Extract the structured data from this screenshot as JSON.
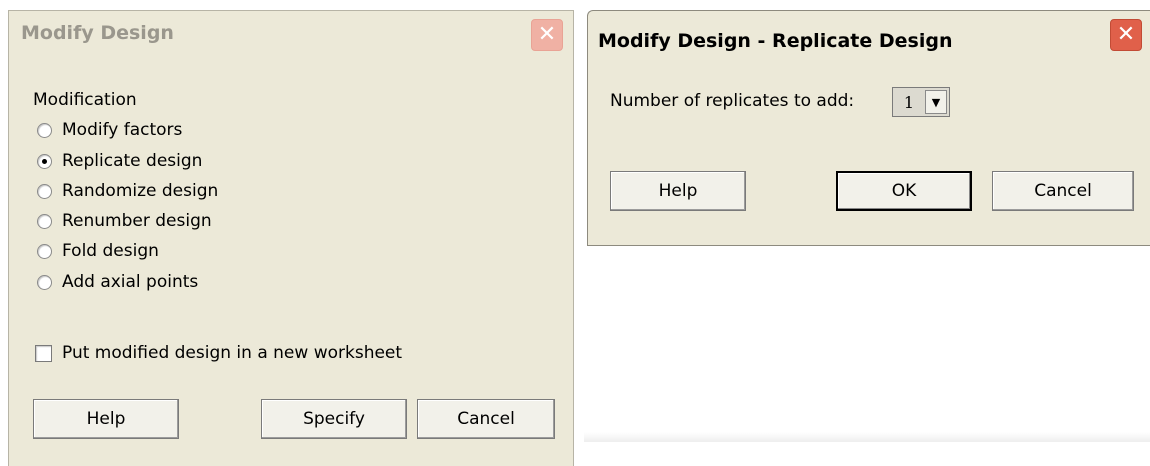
{
  "dialog_modify": {
    "title": "Modify Design",
    "section_label": "Modification",
    "options": [
      {
        "label": "Modify factors",
        "selected": false
      },
      {
        "label": "Replicate design",
        "selected": true
      },
      {
        "label": "Randomize design",
        "selected": false
      },
      {
        "label": "Renumber design",
        "selected": false
      },
      {
        "label": "Fold design",
        "selected": false
      },
      {
        "label": "Add axial points",
        "selected": false
      }
    ],
    "checkbox_label": "Put modified design in a new worksheet",
    "checkbox_checked": false,
    "help_label": "Help",
    "specify_label": "Specify",
    "cancel_label": "Cancel",
    "close_icon": "close-icon"
  },
  "dialog_replicate": {
    "title": "Modify Design - Replicate Design",
    "replicates_label": "Number of replicates to add:",
    "replicates_value": "1",
    "help_label": "Help",
    "ok_label": "OK",
    "cancel_label": "Cancel",
    "close_icon": "close-icon"
  },
  "colors": {
    "dialog_bg": "#ece9d8",
    "close_red": "#e0604a"
  }
}
